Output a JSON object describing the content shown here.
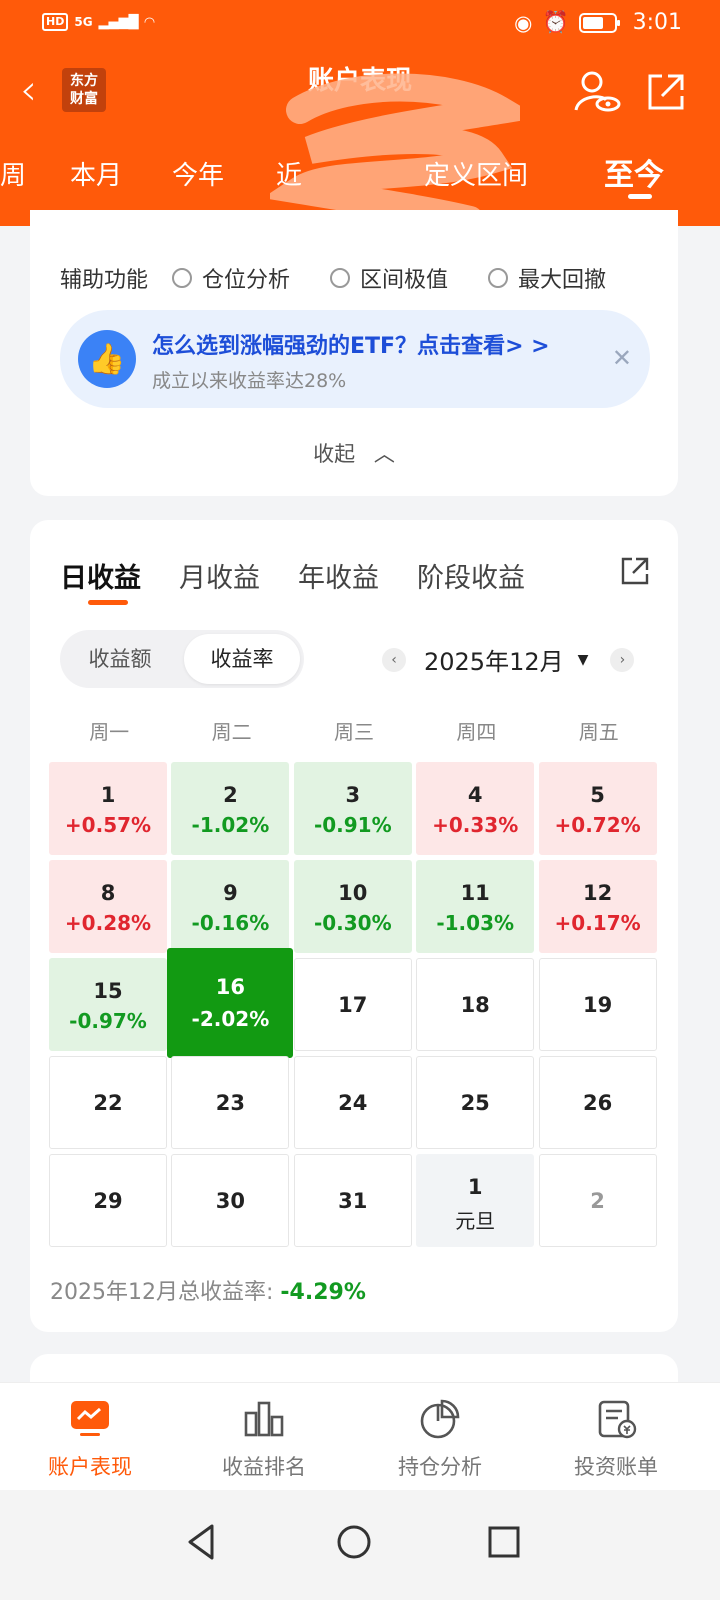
{
  "status_bar": {
    "hd": "HD",
    "network": "5G",
    "time": "3:01"
  },
  "header": {
    "logo_text": "东方财富",
    "title": "账户表现",
    "period_tabs": [
      "周",
      "本月",
      "今年",
      "近",
      "定义区间",
      "至今"
    ],
    "active_period": "至今"
  },
  "aux": {
    "label": "辅助功能",
    "options": [
      "仓位分析",
      "区间极值",
      "最大回撤"
    ]
  },
  "promo": {
    "title": "怎么选到涨幅强劲的ETF？点击查看> >",
    "subtitle": "成立以来收益率达28%"
  },
  "collapse_label": "收起",
  "earnings": {
    "tabs": [
      "日收益",
      "月收益",
      "年收益",
      "阶段收益"
    ],
    "active_tab": "日收益",
    "segment": [
      "收益额",
      "收益率"
    ],
    "active_segment": "收益率",
    "month": "2025年12月",
    "weekdays": [
      "周一",
      "周二",
      "周三",
      "周四",
      "周五"
    ],
    "days": [
      {
        "day": "1",
        "pct": "+0.57%",
        "state": "up"
      },
      {
        "day": "2",
        "pct": "-1.02%",
        "state": "down"
      },
      {
        "day": "3",
        "pct": "-0.91%",
        "state": "down"
      },
      {
        "day": "4",
        "pct": "+0.33%",
        "state": "up"
      },
      {
        "day": "5",
        "pct": "+0.72%",
        "state": "up"
      },
      {
        "day": "8",
        "pct": "+0.28%",
        "state": "up"
      },
      {
        "day": "9",
        "pct": "-0.16%",
        "state": "down"
      },
      {
        "day": "10",
        "pct": "-0.30%",
        "state": "down"
      },
      {
        "day": "11",
        "pct": "-1.03%",
        "state": "down"
      },
      {
        "day": "12",
        "pct": "+0.17%",
        "state": "up"
      },
      {
        "day": "15",
        "pct": "-0.97%",
        "state": "down"
      },
      {
        "day": "16",
        "pct": "-2.02%",
        "state": "strong"
      },
      {
        "day": "17",
        "pct": "",
        "state": "empty"
      },
      {
        "day": "18",
        "pct": "",
        "state": "empty"
      },
      {
        "day": "19",
        "pct": "",
        "state": "empty"
      },
      {
        "day": "22",
        "pct": "",
        "state": "empty"
      },
      {
        "day": "23",
        "pct": "",
        "state": "empty"
      },
      {
        "day": "24",
        "pct": "",
        "state": "empty"
      },
      {
        "day": "25",
        "pct": "",
        "state": "empty"
      },
      {
        "day": "26",
        "pct": "",
        "state": "empty"
      },
      {
        "day": "29",
        "pct": "",
        "state": "empty"
      },
      {
        "day": "30",
        "pct": "",
        "state": "empty"
      },
      {
        "day": "31",
        "pct": "",
        "state": "empty"
      },
      {
        "day": "1",
        "pct": "",
        "state": "holiday",
        "note": "元旦"
      },
      {
        "day": "2",
        "pct": "",
        "state": "next"
      }
    ],
    "total_label": "2025年12月总收益率:",
    "total_value": "-4.29%"
  },
  "colors": {
    "brand": "#ff5a0a",
    "up": "#e0262f",
    "down": "#129a21"
  },
  "bottom_nav": [
    {
      "label": "账户表现",
      "icon": "chart-monitor-icon",
      "active": true
    },
    {
      "label": "收益排名",
      "icon": "bar-rank-icon",
      "active": false
    },
    {
      "label": "持仓分析",
      "icon": "pie-icon",
      "active": false
    },
    {
      "label": "投资账单",
      "icon": "bill-icon",
      "active": false
    }
  ]
}
